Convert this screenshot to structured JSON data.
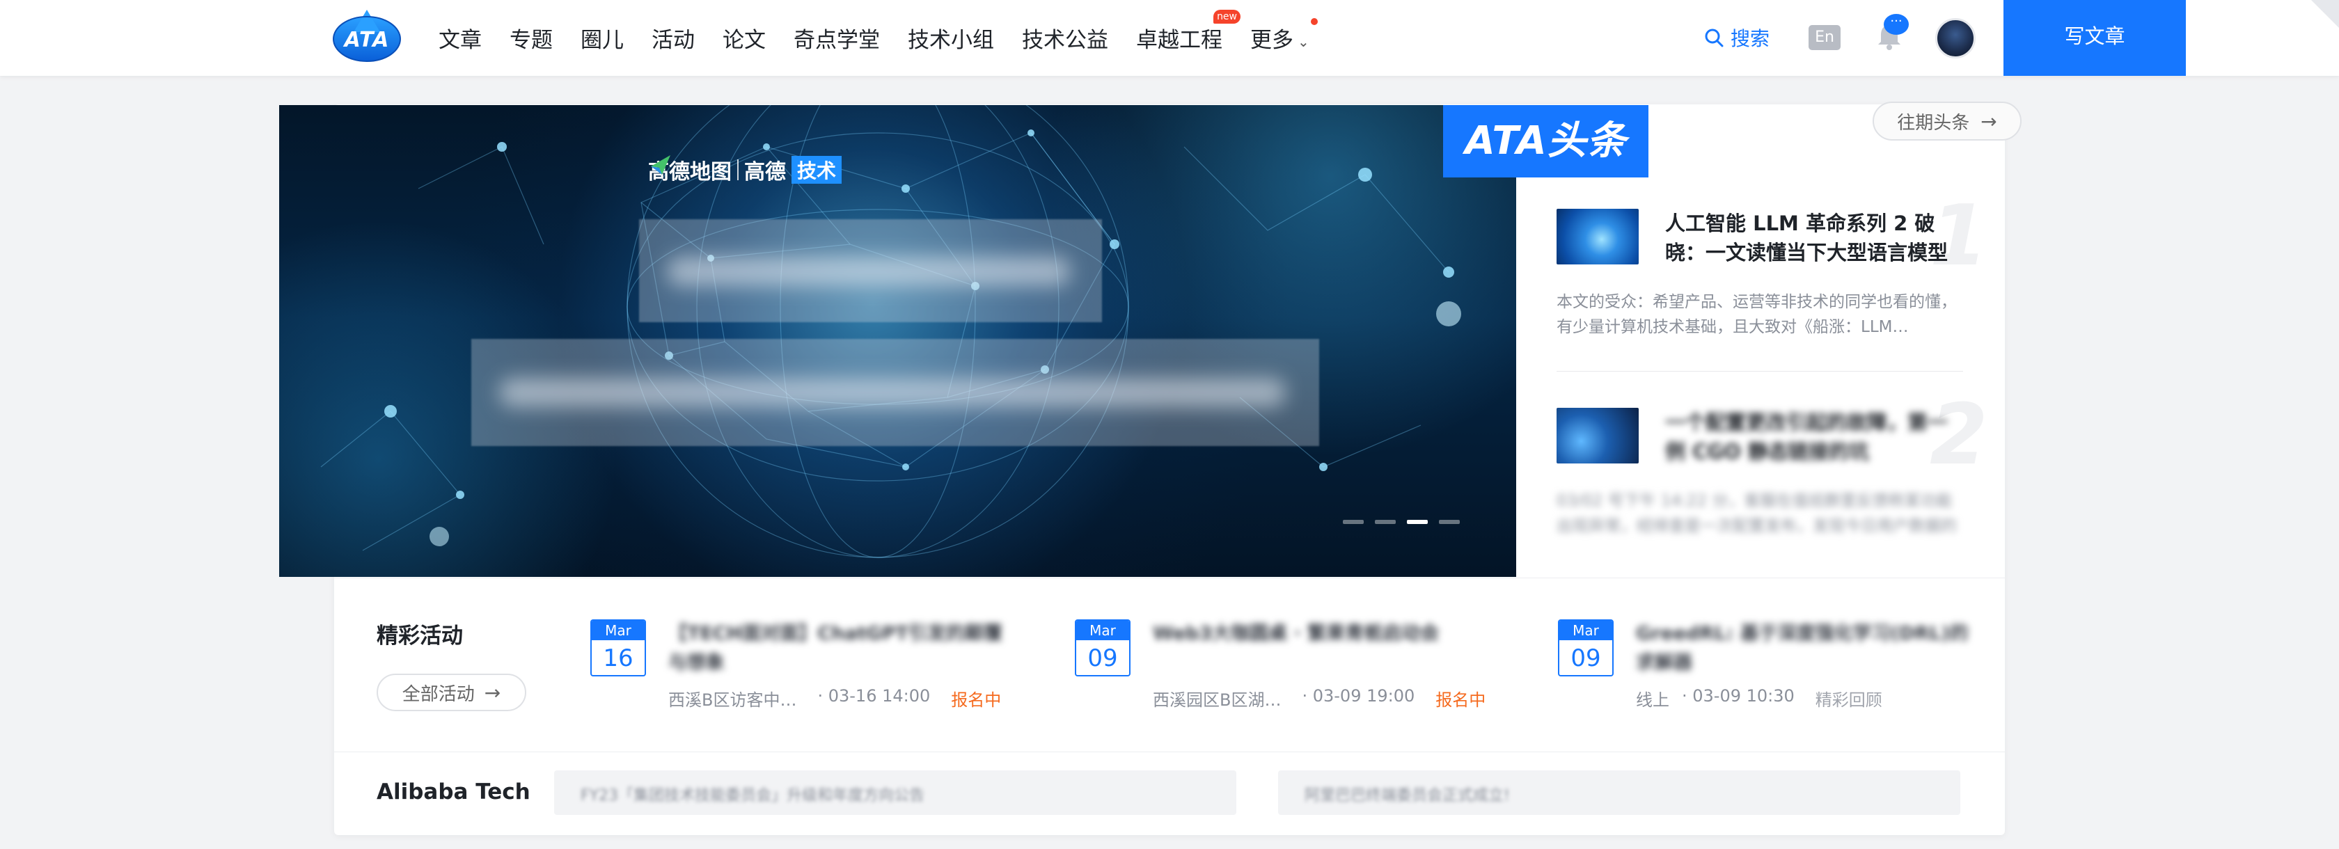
{
  "nav": {
    "logo_text": "ATA",
    "items": [
      "文章",
      "专题",
      "圈儿",
      "活动",
      "论文",
      "奇点学堂",
      "技术小组",
      "技术公益",
      "卓越工程",
      "更多"
    ],
    "new_badge": "new",
    "search_label": "搜索",
    "lang_label": "En",
    "chat_badge": "···",
    "write_label": "写文章"
  },
  "banner": {
    "brand_left": "高德地图",
    "brand_mid": "高德",
    "brand_tag": "技术",
    "slide_count": 4,
    "active_slide": 3
  },
  "headlines": {
    "badge": "ATA头条",
    "past_label": "往期头条",
    "items": [
      {
        "num": "1",
        "title": "人工智能 LLM 革命系列 2 破晓：一文读懂当下大型语言模型发展…",
        "desc": "本文的受众：希望产品、运营等非技术的同学也看的懂，有少量计算机技术基础，且大致对《船涨：LLM…"
      },
      {
        "num": "2",
        "title": "一个配置更改引起的故障，第一例 CGO 静态链接的坑",
        "desc": "03/02 号下午 14:22 分，客服在值班群里反馈称某功能出现异常，经排查是一次配置发布，发现今日用户数据的跳出状态…"
      }
    ]
  },
  "events": {
    "title": "精彩活动",
    "all_label": "全部活动",
    "items": [
      {
        "month": "Mar",
        "day": "16",
        "title": "【TECH面对面】ChatGPT引发的颠覆与想象",
        "location": "西溪B区访客中…",
        "time": "· 03-16 14:00",
        "status": "报名中",
        "status_kind": "on"
      },
      {
        "month": "Mar",
        "day": "09",
        "title": "Web3大咖圆桌 · 繁果青栀启动会",
        "location": "西溪园区B区湖…",
        "time": "· 03-09 19:00",
        "status": "报名中",
        "status_kind": "on"
      },
      {
        "month": "Mar",
        "day": "09",
        "title": "GreedRL: 基于深度强化学习(DRL)的求解器",
        "location": "线上",
        "time": "· 03-09 10:30",
        "status": "精彩回顾",
        "status_kind": "replay"
      }
    ]
  },
  "alibaba": {
    "title": "Alibaba Tech",
    "items": [
      "FY23「集团技术技能委员会」升级和年度方向公告",
      "阿里巴巴终端委员会正式成立!"
    ]
  },
  "colors": {
    "brand_blue": "#1677ff",
    "status_orange": "#f56a1e",
    "badge_red": "#f5432b"
  }
}
